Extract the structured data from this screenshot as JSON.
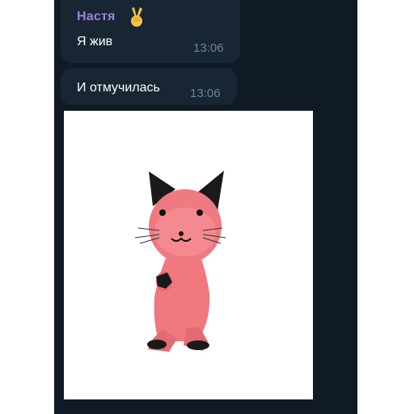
{
  "messages": [
    {
      "sender": "Настя",
      "sender_emoji": "victory-hand-emoji",
      "text": "Я жив",
      "time": "13:06"
    },
    {
      "text": "И отмучилась",
      "time": "13:06"
    }
  ],
  "sticker": {
    "subject": "pink-cat-sticker"
  },
  "colors": {
    "chat_background": "#0f1a26",
    "bubble_background": "#182533",
    "sender_name": "#9f7fe0",
    "timestamp": "#6d8397",
    "cat_body": "#f0787e"
  }
}
